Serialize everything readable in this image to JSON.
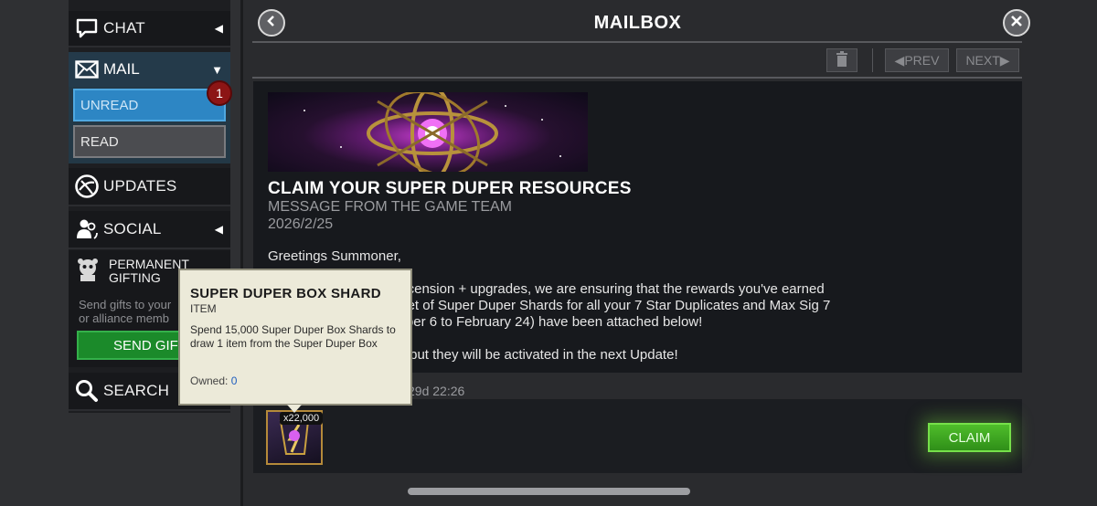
{
  "header": {
    "title": "MAILBOX"
  },
  "toolbar": {
    "prev_label": "◀PREV",
    "next_label": "NEXT▶"
  },
  "sidebar": {
    "chat_label": "CHAT",
    "mail_label": "MAIL",
    "mail_unread_label": "UNREAD",
    "mail_read_label": "READ",
    "unread_badge": "1",
    "updates_label": "UPDATES",
    "social_label": "SOCIAL",
    "gifting_title": "PERMANENT GIFTING",
    "gifting_desc_line1": "Send gifts to your",
    "gifting_desc_line2": "or alliance memb",
    "send_gift_label": "SEND GIFT",
    "search_label": "SEARCH"
  },
  "message": {
    "title": "CLAIM YOUR SUPER DUPER RESOURCES",
    "subtitle": "MESSAGE FROM THE GAME TEAM",
    "date": "2026/2/25",
    "greeting": "Greetings Summoner,",
    "body_line1": "d hyped for the new Ascension + upgrades, we are ensuring that the rewards you've earned",
    "body_line2": "your hands. Your first set of Super Duper Shards for all your 7 Star Duplicates and Max Sig 7",
    "body_line3": "arned between November 6 to February 24) have been attached below!",
    "body_line4": "s can not yet be spent, but they will be activated in the next Update!",
    "expire_text": "29d 22:26"
  },
  "reward": {
    "count": "x22,000",
    "claim_label": "CLAIM"
  },
  "tooltip": {
    "title": "SUPER DUPER BOX SHARD",
    "type": "ITEM",
    "description": "Spend 15,000 Super Duper Box Shards to draw 1 item from the Super Duper Box",
    "owned_label": "Owned:",
    "owned_value": "0"
  },
  "colors": {
    "accent_blue": "#2d86c4",
    "claim_green": "#3aa520",
    "badge_red": "#8c1515",
    "tooltip_bg": "#ecead9"
  }
}
